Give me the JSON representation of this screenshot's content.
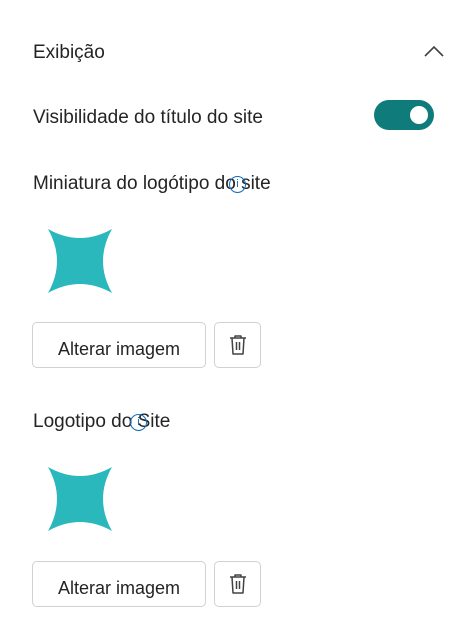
{
  "section": {
    "title": "Exibição",
    "collapse_icon": "chevron-up-icon"
  },
  "site_title_visibility": {
    "label": "Visibilidade do título do site",
    "toggle_on": true,
    "toggle_color": "#0f7b7b"
  },
  "thumbnail": {
    "label": "Miniatura do logótipo do site",
    "info_icon": "info-icon",
    "image_icon": "sparkle-star-icon",
    "image_color": "#2ab8bd",
    "change_button": "Alterar imagem",
    "delete_icon": "trash-icon"
  },
  "site_logo": {
    "label": "Logotipo do Site",
    "info_icon": "info-icon",
    "image_icon": "sparkle-star-icon",
    "image_color": "#2ab8bd",
    "change_button": "Alterar imagem",
    "delete_icon": "trash-icon"
  }
}
